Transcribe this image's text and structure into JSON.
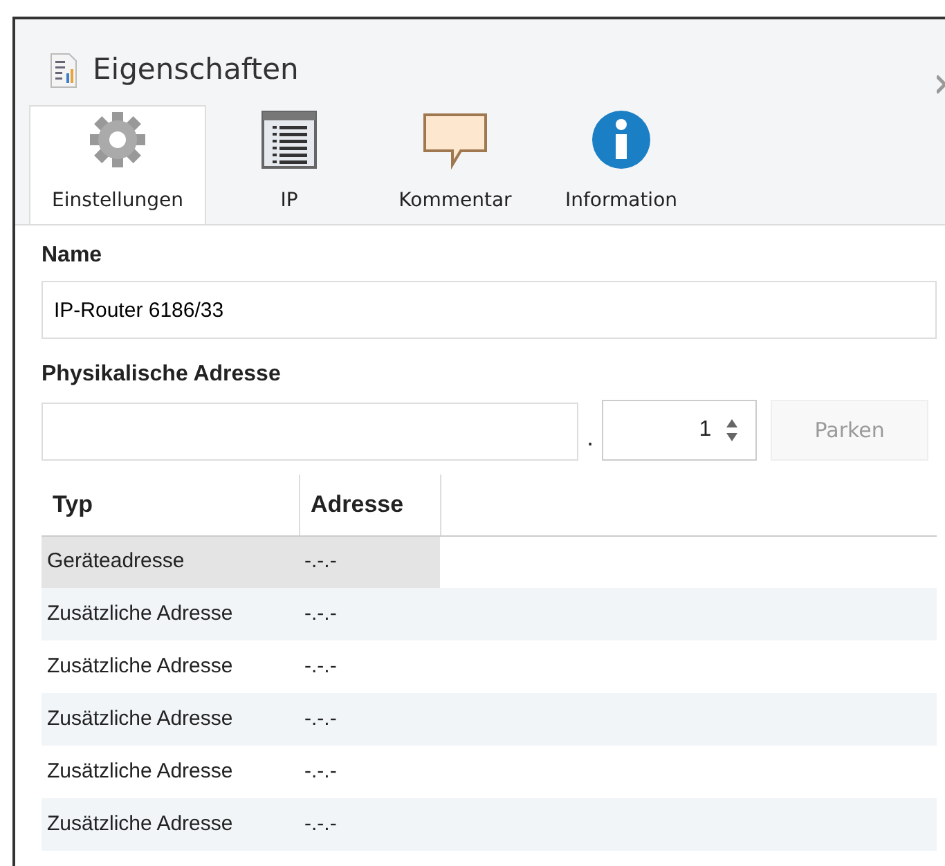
{
  "panel": {
    "title": "Eigenschaften"
  },
  "tabs": [
    {
      "label": "Einstellungen",
      "kind": "gear",
      "selected": true
    },
    {
      "label": "IP",
      "kind": "list",
      "selected": false
    },
    {
      "label": "Kommentar",
      "kind": "comment",
      "selected": false
    },
    {
      "label": "Information",
      "kind": "info",
      "selected": false
    }
  ],
  "name_field": {
    "label": "Name",
    "value": "IP-Router 6186/33"
  },
  "address": {
    "label": "Physikalische Adresse",
    "separator": ".",
    "spinner_value": "1",
    "park_button": {
      "label": "Parken",
      "disabled": true
    }
  },
  "table": {
    "columns": [
      "Typ",
      "Adresse"
    ],
    "rows": [
      {
        "type": "Geräteadresse",
        "address": "-.-.-",
        "selected": true
      },
      {
        "type": "Zusätzliche Adresse",
        "address": "-.-.-",
        "selected": false
      },
      {
        "type": "Zusätzliche Adresse",
        "address": "-.-.-",
        "selected": false
      },
      {
        "type": "Zusätzliche Adresse",
        "address": "-.-.-",
        "selected": false
      },
      {
        "type": "Zusätzliche Adresse",
        "address": "-.-.-",
        "selected": false
      },
      {
        "type": "Zusätzliche Adresse",
        "address": "-.-.-",
        "selected": false
      }
    ]
  }
}
